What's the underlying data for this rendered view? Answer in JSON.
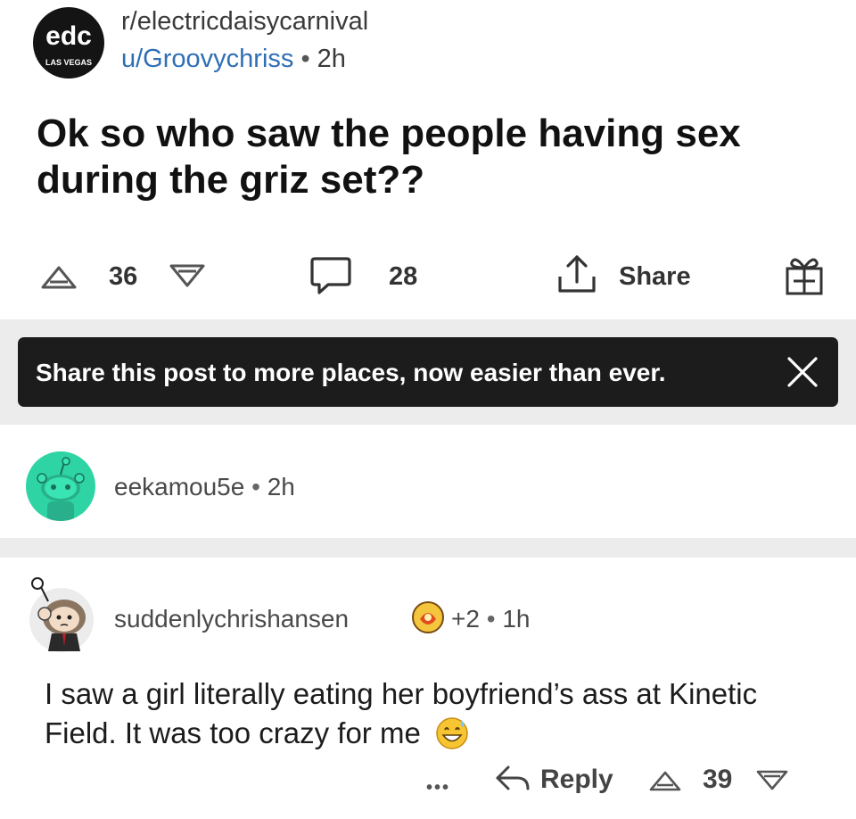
{
  "post": {
    "subreddit": "r/electricdaisycarnival",
    "subreddit_logo_text": "edc",
    "subreddit_logo_subtext": "LAS VEGAS",
    "author": "u/Groovychriss",
    "separator": "•",
    "time": "2h",
    "title": "Ok so who saw the people having sex during the griz set??",
    "score": "36",
    "comment_count": "28",
    "share_label": "Share"
  },
  "toast": {
    "message": "Share this post to more places, now easier than ever."
  },
  "comments": [
    {
      "username": "eekamou5e",
      "separator": "•",
      "time": "2h",
      "avatar_color": "#2fd4a4"
    },
    {
      "username": "suddenlychrishansen",
      "flair_count": "+2",
      "separator": "•",
      "time": "1h",
      "body": "I saw a girl literally eating her boyfriend’s ass at Kinetic Field. It was too crazy for me",
      "more_label": "•••",
      "reply_label": "Reply",
      "score": "39"
    }
  ],
  "colors": {
    "author_link": "#2f6fb5",
    "toast_bg": "#1c1c1c",
    "band_bg": "#ececec"
  },
  "icons": [
    "upvote-icon",
    "downvote-icon",
    "comment-bubble-icon",
    "share-icon",
    "gift-icon",
    "close-icon",
    "reply-arrow-icon",
    "more-options-icon",
    "award-icon",
    "emoji-icon"
  ]
}
